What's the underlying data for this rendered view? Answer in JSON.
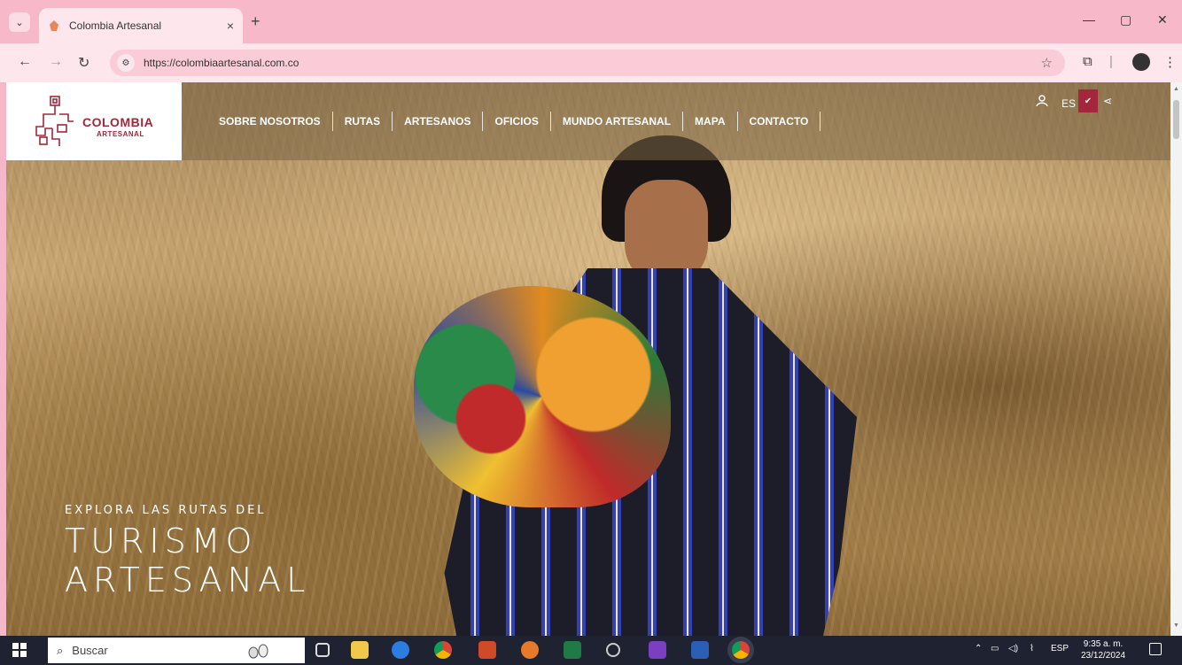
{
  "browser": {
    "tab_title": "Colombia Artesanal",
    "tab_close": "×",
    "new_tab": "+",
    "url": "https://colombiaartesanal.com.co",
    "window_controls": [
      "—",
      "▢",
      "✕"
    ]
  },
  "site": {
    "logo_line1": "COLOMBIA",
    "logo_line2": "ARTESANAL",
    "nav": [
      "SOBRE NOSOTROS",
      "RUTAS",
      "ARTESANOS",
      "OFICIOS",
      "MUNDO ARTESANAL",
      "MAPA",
      "CONTACTO"
    ],
    "language": "ES"
  },
  "hero": {
    "subtitle": "EXPLORA LAS RUTAS DEL",
    "title_line1": "TURISMO",
    "title_line2": "ARTESANAL"
  },
  "taskbar": {
    "search_placeholder": "Buscar",
    "language": "ESP",
    "time": "9:35 a. m.",
    "date": "23/12/2024"
  },
  "colors": {
    "brand_red": "#a3263a",
    "browser_pink": "#f7b9c9"
  }
}
